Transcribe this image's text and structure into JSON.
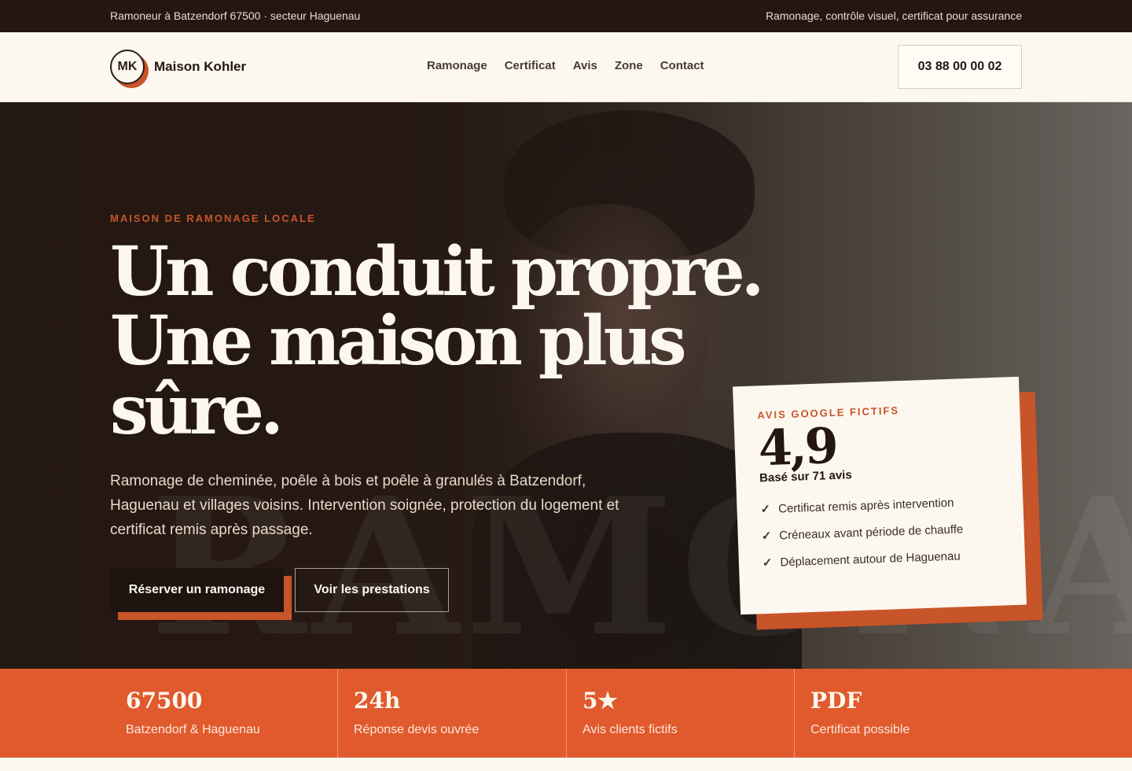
{
  "topbar": {
    "left": "Ramoneur à Batzendorf 67500 · secteur Haguenau",
    "right": "Ramonage, contrôle visuel, certificat pour assurance"
  },
  "header": {
    "logo_initials": "MK",
    "brand": "Maison Kohler",
    "nav": [
      {
        "label": "Ramonage"
      },
      {
        "label": "Certificat"
      },
      {
        "label": "Avis"
      },
      {
        "label": "Zone"
      },
      {
        "label": "Contact"
      }
    ],
    "phone": "03 88 00 00 02"
  },
  "hero": {
    "eyebrow": "MAISON DE RAMONAGE LOCALE",
    "headline_lines": [
      "Un conduit propre.",
      "Une maison plus",
      "sûre."
    ],
    "lead": "Ramonage de cheminée, poêle à bois et poêle à granulés à Batzendorf, Haguenau et villages voisins. Intervention soignée, protection du logement et certificat remis après passage.",
    "primary_cta": "Réserver un ramonage",
    "secondary_cta": "Voir les prestations",
    "watermark": "RAMONAGE"
  },
  "review_card": {
    "label": "AVIS GOOGLE FICTIFS",
    "score": "4,9",
    "basis": "Basé sur 71 avis",
    "items": [
      {
        "text": "Certificat remis après intervention"
      },
      {
        "text": "Créneaux avant période de chauffe"
      },
      {
        "text": "Déplacement autour de Haguenau"
      }
    ]
  },
  "stats": [
    {
      "value": "67500",
      "label": "Batzendorf & Haguenau"
    },
    {
      "value": "24h",
      "label": "Réponse devis ouvrée"
    },
    {
      "value": "5★",
      "label": "Avis clients fictifs"
    },
    {
      "value": "PDF",
      "label": "Certificat possible"
    }
  ],
  "colors": {
    "accent": "#e05a2d",
    "dark": "#241712",
    "cream": "#fdf8ef"
  }
}
